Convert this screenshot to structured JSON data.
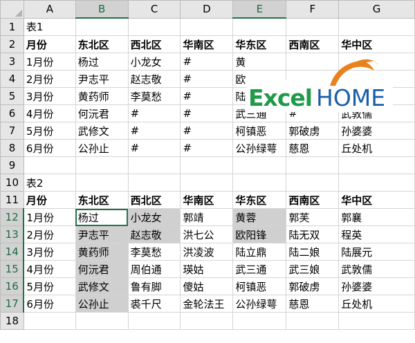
{
  "columns": [
    "A",
    "B",
    "C",
    "D",
    "E",
    "F",
    "G"
  ],
  "rows": [
    "1",
    "2",
    "3",
    "4",
    "5",
    "6",
    "7",
    "8",
    "9",
    "10",
    "11",
    "12",
    "13",
    "14",
    "15",
    "16",
    "17",
    "18"
  ],
  "table1": {
    "label": "表1",
    "headers": [
      "月份",
      "东北区",
      "西北区",
      "华南区",
      "华东区",
      "西南区",
      "华中区"
    ],
    "rows": [
      [
        "1月份",
        "杨过",
        "小龙女",
        "#",
        "黄",
        "",
        ""
      ],
      [
        "2月份",
        "尹志平",
        "赵志敬",
        "#",
        "欧",
        "",
        ""
      ],
      [
        "3月份",
        "黄药师",
        "李莫愁",
        "#",
        "陆",
        "",
        ""
      ],
      [
        "4月份",
        "何沅君",
        "#",
        "#",
        "武三通",
        "#",
        "武敦儒"
      ],
      [
        "5月份",
        "武修文",
        "#",
        "#",
        "柯镇恶",
        "郭破虏",
        "孙婆婆"
      ],
      [
        "6月份",
        "公孙止",
        "#",
        "#",
        "公孙绿萼",
        "慈恩",
        "丘处机"
      ]
    ]
  },
  "table2": {
    "label": "表2",
    "headers": [
      "月份",
      "东北区",
      "西北区",
      "华南区",
      "华东区",
      "西南区",
      "华中区"
    ],
    "rows": [
      [
        "1月份",
        "杨过",
        "小龙女",
        "郭靖",
        "黄蓉",
        "郭芙",
        "郭襄"
      ],
      [
        "2月份",
        "尹志平",
        "赵志敬",
        "洪七公",
        "欧阳锋",
        "陆无双",
        "程英"
      ],
      [
        "3月份",
        "黄药师",
        "李莫愁",
        "洪凌波",
        "陆立鼎",
        "陆二娘",
        "陆展元"
      ],
      [
        "4月份",
        "何沅君",
        "周伯通",
        "瑛姑",
        "武三通",
        "武三娘",
        "武敦儒"
      ],
      [
        "5月份",
        "武修文",
        "鲁有脚",
        "傻姑",
        "柯镇恶",
        "郭破虏",
        "孙婆婆"
      ],
      [
        "6月份",
        "公孙止",
        "裘千尺",
        "金轮法王",
        "公孙绿萼",
        "慈恩",
        "丘处机"
      ]
    ]
  },
  "logo": {
    "part1": "Excel",
    "part2": "HOME",
    "colors": {
      "excel": "#1f9a4a",
      "home": "#1a5ea8",
      "roof": "#e8821e"
    }
  },
  "selection_color": "#217346",
  "highlight_color": "#d0d0d0"
}
